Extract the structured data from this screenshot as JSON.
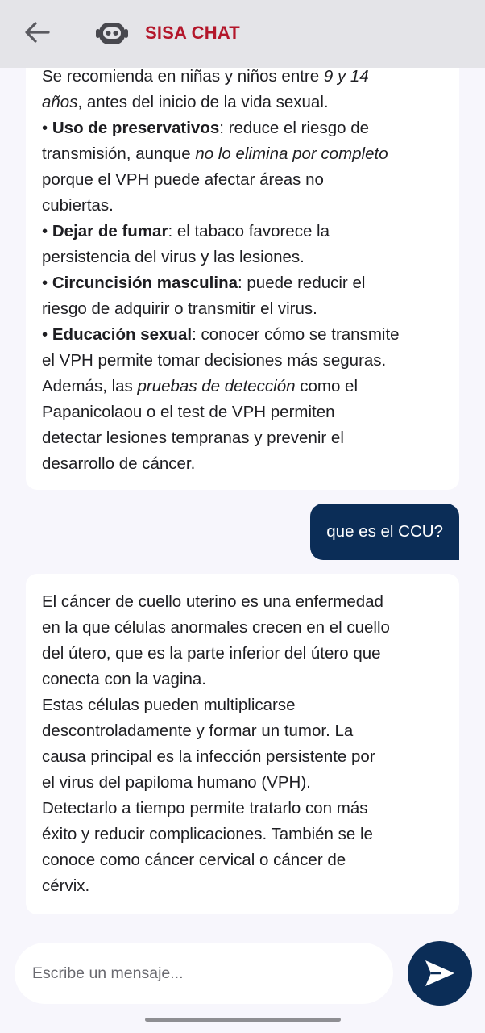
{
  "header": {
    "title": "SISA CHAT",
    "back_icon": "arrow-left-icon",
    "bot_icon": "robot-icon"
  },
  "messages": [
    {
      "role": "bot",
      "lines": [
        [
          {
            "t": "Se recomienda en niñas y niños entre "
          },
          {
            "t": "9 y 14",
            "i": true
          }
        ],
        [
          {
            "t": "años",
            "i": true
          },
          {
            "t": ", antes del inicio de la vida sexual."
          }
        ],
        [
          {
            "t": "• "
          },
          {
            "t": "Uso de preservativos",
            "b": true
          },
          {
            "t": ": reduce el riesgo de"
          }
        ],
        [
          {
            "t": "transmisión, aunque "
          },
          {
            "t": "no lo elimina por completo",
            "i": true
          }
        ],
        [
          {
            "t": "porque el VPH puede afectar áreas no"
          }
        ],
        [
          {
            "t": "cubiertas."
          }
        ],
        [
          {
            "t": "• "
          },
          {
            "t": "Dejar de fumar",
            "b": true
          },
          {
            "t": ": el tabaco favorece la"
          }
        ],
        [
          {
            "t": "persistencia del virus y las lesiones."
          }
        ],
        [
          {
            "t": "• "
          },
          {
            "t": "Circuncisión masculina",
            "b": true
          },
          {
            "t": ": puede reducir el"
          }
        ],
        [
          {
            "t": "riesgo de adquirir o transmitir el virus."
          }
        ],
        [
          {
            "t": "• "
          },
          {
            "t": "Educación sexual",
            "b": true
          },
          {
            "t": ": conocer cómo se transmite"
          }
        ],
        [
          {
            "t": "el VPH permite tomar decisiones más seguras."
          }
        ],
        [
          {
            "t": "Además, las "
          },
          {
            "t": "pruebas de detección",
            "i": true
          },
          {
            "t": " como el"
          }
        ],
        [
          {
            "t": "Papanicolaou o el test de VPH permiten"
          }
        ],
        [
          {
            "t": "detectar lesiones tempranas y prevenir el"
          }
        ],
        [
          {
            "t": "desarrollo de cáncer."
          }
        ]
      ]
    },
    {
      "role": "user",
      "text": "que es el CCU?"
    },
    {
      "role": "bot",
      "lines": [
        [
          {
            "t": "El cáncer de cuello uterino es una enfermedad"
          }
        ],
        [
          {
            "t": "en la que células anormales crecen en el cuello"
          }
        ],
        [
          {
            "t": "del útero, que es la parte inferior del útero que"
          }
        ],
        [
          {
            "t": "conecta con la vagina."
          }
        ],
        [
          {
            "t": "Estas células pueden multiplicarse"
          }
        ],
        [
          {
            "t": "descontroladamente y formar un tumor. La"
          }
        ],
        [
          {
            "t": "causa principal es la infección persistente por"
          }
        ],
        [
          {
            "t": "el virus del papiloma humano (VPH)."
          }
        ],
        [
          {
            "t": "Detectarlo a tiempo permite tratarlo con más"
          }
        ],
        [
          {
            "t": "éxito y reducir complicaciones. También se le"
          }
        ],
        [
          {
            "t": "conoce como cáncer cervical o cáncer de"
          }
        ],
        [
          {
            "t": "cérvix."
          }
        ]
      ]
    }
  ],
  "input": {
    "placeholder": "Escribe un mensaje...",
    "value": ""
  },
  "send_icon": "send-icon",
  "colors": {
    "header_bg": "#e4e4e8",
    "title": "#b3162a",
    "accent": "#0b2d57",
    "background": "#f7f6fc"
  }
}
